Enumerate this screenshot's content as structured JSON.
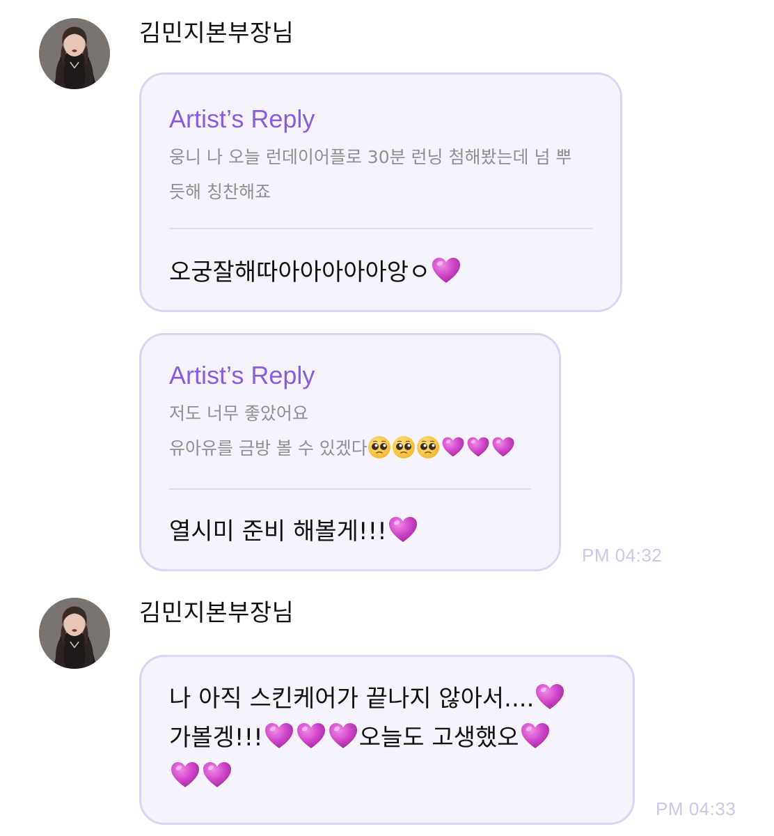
{
  "messages": [
    {
      "sender": "김민지본부장님",
      "replies": [
        {
          "title": "Artist’s Reply",
          "quote_lines": [
            "웅니 나 오늘 런데이어플로 30분 런닝 첨해봤는데 넘 뿌",
            "듯해 칭찬해죠"
          ],
          "message": "오궁잘해따아아아아아앙ㅇ",
          "message_emoji": [
            "purple-heart-emoji"
          ]
        },
        {
          "title": "Artist’s Reply",
          "quote_lines": [
            "저도 너무 좋았어요",
            "유아유를 금방 볼 수 있겠다"
          ],
          "quote_emoji": [
            "pleading-face-emoji",
            "pleading-face-emoji",
            "pleading-face-emoji",
            "purple-heart-emoji",
            "purple-heart-emoji",
            "purple-heart-emoji"
          ],
          "message": "열시미 준비 해볼게!!!",
          "message_emoji": [
            "purple-heart-emoji"
          ],
          "time": "PM 04:32"
        }
      ]
    },
    {
      "sender": "김민지본부장님",
      "text_lines": [
        "나 아직 스킨케어가 끝나지 않아서....",
        "가볼겡!!!",
        "오늘도 고생했오"
      ],
      "time": "PM 04:33"
    }
  ],
  "colors": {
    "accent": "#8a5ce6",
    "bubble_bg": "#f5f3fb",
    "bubble_border": "#ddd3f4",
    "timestamp": "#cdc8ee",
    "heart": "#cc3fc5"
  }
}
